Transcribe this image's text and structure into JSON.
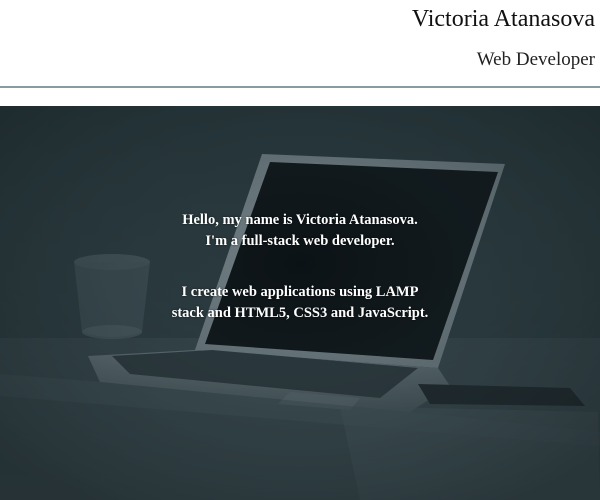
{
  "header": {
    "name": "Victoria Atanasova",
    "role": "Web Developer"
  },
  "hero": {
    "intro_line_1": "Hello, my name is Victoria Atanasova.",
    "intro_line_2": "I'm a full-stack web developer.",
    "skills_line_1": "I create web applications using LAMP",
    "skills_line_2": "stack and HTML5, CSS3 and JavaScript.",
    "background_photo": "laptop-on-desk-photo"
  },
  "colors": {
    "header_bg": "#ffffff",
    "divider": "#8a9aa3",
    "hero_overlay": "#2a3b3f",
    "hero_text": "#ffffff"
  }
}
